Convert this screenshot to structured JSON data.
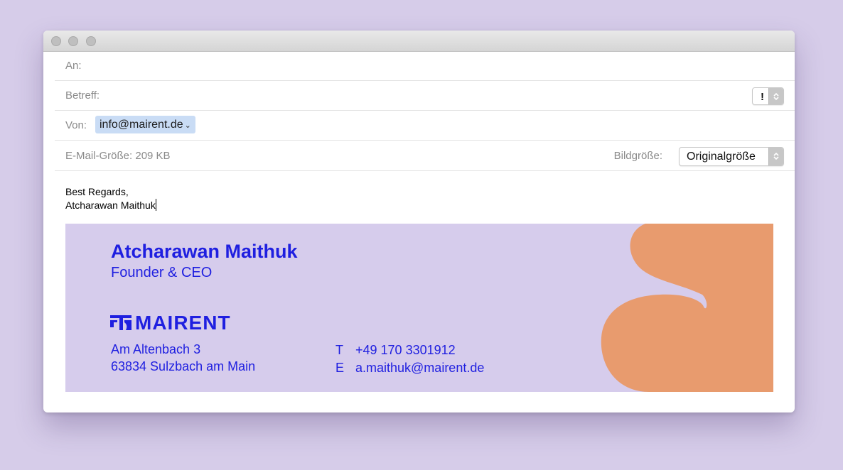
{
  "compose": {
    "to_label": "An:",
    "subject_label": "Betreff:",
    "priority_value": "!",
    "from_label": "Von:",
    "from_value": "info@mairent.de",
    "size_label": "E-Mail-Größe:",
    "size_value": "209 KB",
    "image_size_label": "Bildgröße:",
    "image_size_value": "Originalgröße"
  },
  "body": {
    "line1": "Best Regards,",
    "line2": "Atcharawan Maithuk"
  },
  "signature": {
    "name": "Atcharawan Maithuk",
    "role": "Founder & CEO",
    "company": "MAIRENT",
    "address_line1": "Am Altenbach 3",
    "address_line2": "63834 Sulzbach am Main",
    "phone_key": "T",
    "phone": "+49 170 3301912",
    "email_key": "E",
    "email": "a.maithuk@mairent.de",
    "brand_color": "#1f1fe0",
    "background_color": "#d6ccec",
    "shape_color": "#e89b6e"
  }
}
